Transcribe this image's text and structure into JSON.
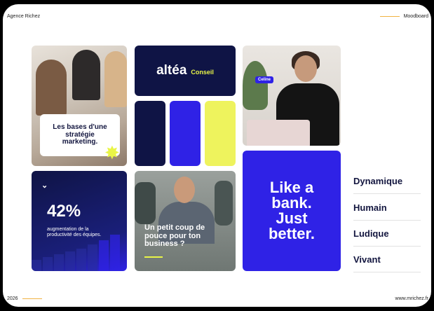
{
  "header": {
    "agency": "Agence Richez",
    "title": "Moodboard"
  },
  "footer": {
    "year": "2026",
    "website": "www.mrichez.fr"
  },
  "tiles": {
    "strategy_card": "Les bases d'une stratégie marketing.",
    "logo_brand": "altéa",
    "logo_sub": "Conseil",
    "portrait_badge": "Celine",
    "stat_value": "42%",
    "stat_desc": "augmentation de la productivité des équipes.",
    "coup_text": "Un petit coup de pouce pour ton business ?",
    "bank_text": "Like a bank. Just better."
  },
  "keywords": [
    "Dynamique",
    "Humain",
    "Ludique",
    "Vivant"
  ],
  "colors": {
    "navy": "#0f1445",
    "blue": "#2f22e6",
    "yellow": "#eef35d"
  },
  "icons": {
    "star": "star-icon",
    "chevron": "chevron-icon"
  }
}
